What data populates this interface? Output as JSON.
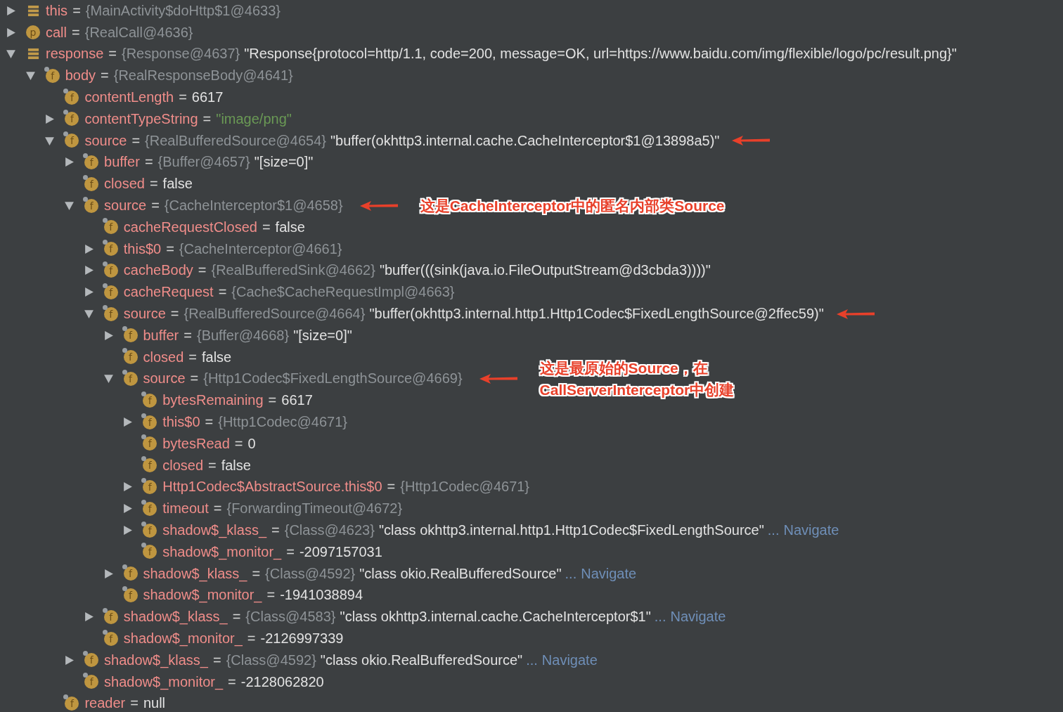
{
  "tree": [
    {
      "kind": "list",
      "name": "this",
      "eq": "=",
      "type": "{MainActivity$doHttp$1@4633}",
      "expanded": false
    },
    {
      "kind": "param",
      "badge": "p",
      "name": "call",
      "eq": "=",
      "type": "{RealCall@4636}",
      "expanded": false
    },
    {
      "kind": "list",
      "name": "response",
      "eq": "=",
      "type": "{Response@4637}",
      "value": "\"Response{protocol=http/1.1, code=200, message=OK, url=https://www.baidu.com/img/flexible/logo/pc/result.png}\"",
      "expanded": true,
      "children": [
        {
          "kind": "field",
          "badge": "f",
          "name": "body",
          "eq": "=",
          "type": "{RealResponseBody@4641}",
          "expanded": true,
          "children": [
            {
              "kind": "field",
              "badge": "f",
              "name": "contentLength",
              "eq": "=",
              "value": "6617"
            },
            {
              "kind": "string_field",
              "badge": "f",
              "name": "contentTypeString",
              "eq": "=",
              "value": "\"image/png\"",
              "expanded": false
            },
            {
              "kind": "field",
              "badge": "f",
              "name": "source",
              "eq": "=",
              "type": "{RealBufferedSource@4654}",
              "value": "\"buffer(okhttp3.internal.cache.CacheInterceptor$1@13898a5)\"",
              "arrow": true,
              "expanded": true,
              "children": [
                {
                  "kind": "field",
                  "badge": "f",
                  "name": "buffer",
                  "eq": "=",
                  "type": "{Buffer@4657}",
                  "value": "\"[size=0]\"",
                  "expanded": false
                },
                {
                  "kind": "field",
                  "badge": "f",
                  "name": "closed",
                  "eq": "=",
                  "value": "false"
                },
                {
                  "kind": "field",
                  "badge": "f",
                  "name": "source",
                  "eq": "=",
                  "type": "{CacheInterceptor$1@4658}",
                  "arrow": true,
                  "note": "这是CacheInterceptor中的匿名内部类Source",
                  "expanded": true,
                  "children": [
                    {
                      "kind": "field",
                      "badge": "f",
                      "name": "cacheRequestClosed",
                      "eq": "=",
                      "value": "false"
                    },
                    {
                      "kind": "field",
                      "badge": "f",
                      "name": "this$0",
                      "eq": "=",
                      "type": "{CacheInterceptor@4661}",
                      "expanded": false
                    },
                    {
                      "kind": "field",
                      "badge": "f",
                      "name": "cacheBody",
                      "eq": "=",
                      "type": "{RealBufferedSink@4662}",
                      "value": "\"buffer(((sink(java.io.FileOutputStream@d3cbda3))))\"",
                      "expanded": false
                    },
                    {
                      "kind": "field",
                      "badge": "f",
                      "name": "cacheRequest",
                      "eq": "=",
                      "type": "{Cache$CacheRequestImpl@4663}",
                      "expanded": false
                    },
                    {
                      "kind": "field",
                      "badge": "f",
                      "name": "source",
                      "eq": "=",
                      "type": "{RealBufferedSource@4664}",
                      "value": "\"buffer(okhttp3.internal.http1.Http1Codec$FixedLengthSource@2ffec59)\"",
                      "arrow": true,
                      "expanded": true,
                      "children": [
                        {
                          "kind": "field",
                          "badge": "f",
                          "name": "buffer",
                          "eq": "=",
                          "type": "{Buffer@4668}",
                          "value": "\"[size=0]\"",
                          "expanded": false
                        },
                        {
                          "kind": "field",
                          "badge": "f",
                          "name": "closed",
                          "eq": "=",
                          "value": "false"
                        },
                        {
                          "kind": "field",
                          "badge": "f",
                          "name": "source",
                          "eq": "=",
                          "type": "{Http1Codec$FixedLengthSource@4669}",
                          "arrow": true,
                          "note": "这是最原始的Source，在\nCallServerInterceptor中创建",
                          "expanded": true,
                          "children": [
                            {
                              "kind": "field",
                              "badge": "f",
                              "name": "bytesRemaining",
                              "eq": "=",
                              "value": "6617"
                            },
                            {
                              "kind": "field",
                              "badge": "f",
                              "name": "this$0",
                              "eq": "=",
                              "type": "{Http1Codec@4671}",
                              "expanded": false
                            },
                            {
                              "kind": "field",
                              "badge": "f",
                              "name": "bytesRead",
                              "eq": "=",
                              "value": "0"
                            },
                            {
                              "kind": "field",
                              "badge": "f",
                              "name": "closed",
                              "eq": "=",
                              "value": "false"
                            },
                            {
                              "kind": "field",
                              "badge": "f",
                              "name": "Http1Codec$AbstractSource.this$0",
                              "eq": "=",
                              "type": "{Http1Codec@4671}",
                              "expanded": false
                            },
                            {
                              "kind": "field",
                              "badge": "f",
                              "name": "timeout",
                              "eq": "=",
                              "type": "{ForwardingTimeout@4672}",
                              "expanded": false
                            },
                            {
                              "kind": "field",
                              "badge": "f",
                              "name": "shadow$_klass_",
                              "eq": "=",
                              "type": "{Class@4623}",
                              "value": "\"class okhttp3.internal.http1.Http1Codec$FixedLengthSource\"",
                              "more": "...",
                              "link": "Navigate",
                              "expanded": false
                            },
                            {
                              "kind": "field",
                              "badge": "f",
                              "name": "shadow$_monitor_",
                              "eq": "=",
                              "value": "-2097157031"
                            }
                          ]
                        },
                        {
                          "kind": "field",
                          "badge": "f",
                          "name": "shadow$_klass_",
                          "eq": "=",
                          "type": "{Class@4592}",
                          "value": "\"class okio.RealBufferedSource\"",
                          "more": "...",
                          "link": "Navigate",
                          "expanded": false
                        },
                        {
                          "kind": "field",
                          "badge": "f",
                          "name": "shadow$_monitor_",
                          "eq": "=",
                          "value": "-1941038894"
                        }
                      ]
                    },
                    {
                      "kind": "field",
                      "badge": "f",
                      "name": "shadow$_klass_",
                      "eq": "=",
                      "type": "{Class@4583}",
                      "value": "\"class okhttp3.internal.cache.CacheInterceptor$1\"",
                      "more": "...",
                      "link": "Navigate",
                      "expanded": false
                    },
                    {
                      "kind": "field",
                      "badge": "f",
                      "name": "shadow$_monitor_",
                      "eq": "=",
                      "value": "-2126997339"
                    }
                  ]
                },
                {
                  "kind": "field",
                  "badge": "f",
                  "name": "shadow$_klass_",
                  "eq": "=",
                  "type": "{Class@4592}",
                  "value": "\"class okio.RealBufferedSource\"",
                  "more": "...",
                  "link": "Navigate",
                  "expanded": false
                },
                {
                  "kind": "field",
                  "badge": "f",
                  "name": "shadow$_monitor_",
                  "eq": "=",
                  "value": "-2128062820"
                }
              ]
            },
            {
              "kind": "field",
              "badge": "f",
              "name": "reader",
              "eq": "=",
              "value": "null"
            }
          ]
        }
      ]
    }
  ]
}
